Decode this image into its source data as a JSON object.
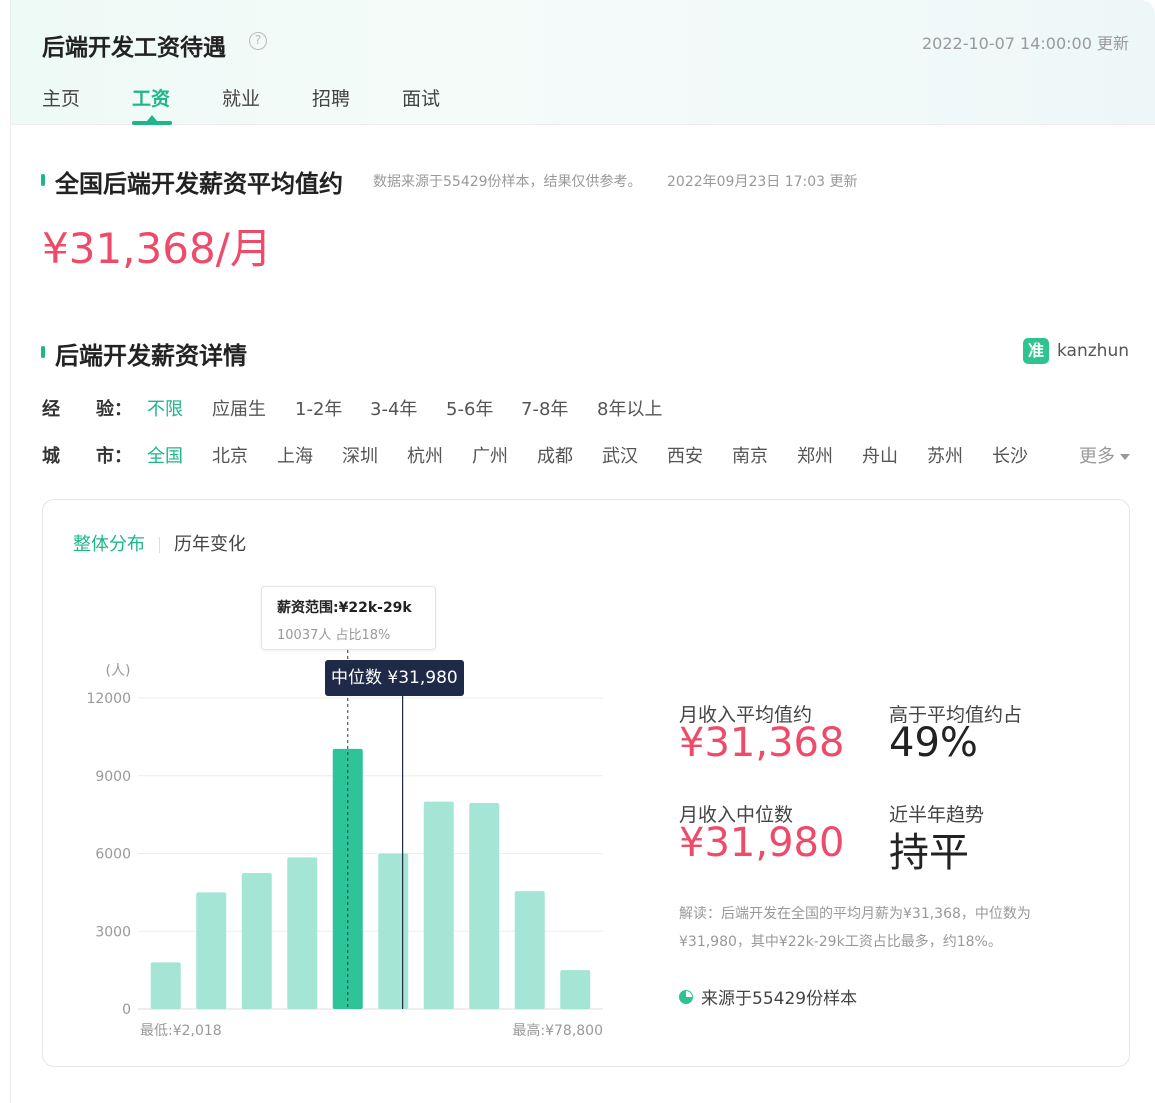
{
  "header": {
    "title": "后端开发工资待遇",
    "help_icon": "?",
    "update_time": "2022-10-07 14:00:00 更新",
    "tabs": [
      {
        "label": "主页"
      },
      {
        "label": "工资"
      },
      {
        "label": "就业"
      },
      {
        "label": "招聘"
      },
      {
        "label": "面试"
      }
    ],
    "active_tab": "工资"
  },
  "summary": {
    "title": "全国后端开发薪资平均值约",
    "note": "数据来源于55429份样本，结果仅供参考。",
    "note_time": "2022年09月23日 17:03 更新",
    "avg_salary": "¥31,368/月"
  },
  "details": {
    "title": "后端开发薪资详情",
    "brand_icon": "准",
    "brand_name": "kanzhun",
    "experience": {
      "label": "经　　验：",
      "options": [
        "不限",
        "应届生",
        "1-2年",
        "3-4年",
        "5-6年",
        "7-8年",
        "8年以上"
      ],
      "selected": "不限"
    },
    "city": {
      "label": "城　　市：",
      "options": [
        "全国",
        "北京",
        "上海",
        "深圳",
        "杭州",
        "广州",
        "成都",
        "武汉",
        "西安",
        "南京",
        "郑州",
        "舟山",
        "苏州",
        "长沙"
      ],
      "selected": "全国",
      "more_label": "更多"
    }
  },
  "panel": {
    "subtabs": [
      {
        "label": "整体分布"
      },
      {
        "label": "历年变化"
      }
    ],
    "active_subtab": "整体分布",
    "tooltip": {
      "line1": "薪资范围:¥22k-29k",
      "line2": "10037人  占比18%"
    },
    "median_flag": "中位数 ¥31,980",
    "stats": {
      "avg_label": "月收入平均值约",
      "avg_value": "¥31,368",
      "above_label": "高于平均值约占",
      "above_value": "49%",
      "median_label": "月收入中位数",
      "median_value": "¥31,980",
      "trend_label": "近半年趋势",
      "trend_value": "持平"
    },
    "interpretation": "解读：后端开发在全国的平均月薪为¥31,368，中位数为¥31,980，其中¥22k-29k工资占比最多，约18%。",
    "source": "来源于55429份样本"
  },
  "chart_data": {
    "type": "bar",
    "unit_label": "(人)",
    "ylim": [
      0,
      12000
    ],
    "yticks": [
      0,
      3000,
      6000,
      9000,
      12000
    ],
    "values": [
      1800,
      4500,
      5250,
      5850,
      10037,
      6000,
      8000,
      7950,
      4550,
      1500
    ],
    "highlight_index": 4,
    "median_position": 5.25,
    "min_label": "最低:¥2,018",
    "max_label": "最高:¥78,800",
    "colors": {
      "bar": "#a4e5d6",
      "highlight": "#2ec49a",
      "grid": "#eeeeee",
      "median_line": "#1e2a48"
    }
  }
}
